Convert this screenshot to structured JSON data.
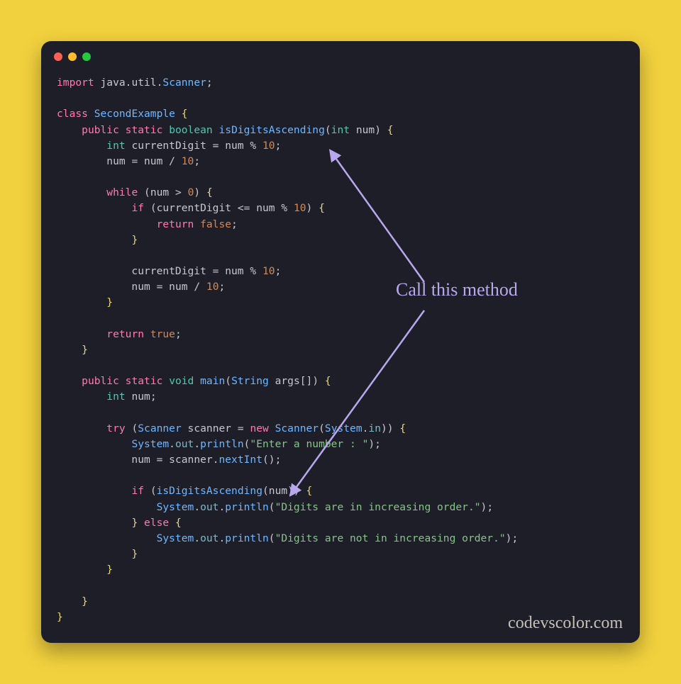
{
  "colors": {
    "page_bg": "#f2d13e",
    "editor_bg": "#1e1e28",
    "keyword": "#ff7ab2",
    "type": "#4ec9b0",
    "class": "#6fb7ff",
    "number": "#d08a5a",
    "brace": "#e8d87a",
    "string": "#87c38a",
    "annotation": "#b9a8ee"
  },
  "window": {
    "controls": [
      "close",
      "minimize",
      "zoom"
    ]
  },
  "code": {
    "lines": [
      [
        [
          "kw",
          "import"
        ],
        [
          "punc",
          " java"
        ],
        [
          "punc",
          "."
        ],
        [
          "punc",
          "util"
        ],
        [
          "punc",
          "."
        ],
        [
          "cls",
          "Scanner"
        ],
        [
          "punc",
          ";"
        ]
      ],
      [],
      [
        [
          "kw",
          "class"
        ],
        [
          "punc",
          " "
        ],
        [
          "cls",
          "SecondExample"
        ],
        [
          "punc",
          " "
        ],
        [
          "brace",
          "{"
        ]
      ],
      [
        [
          "punc",
          "    "
        ],
        [
          "kw",
          "public"
        ],
        [
          "punc",
          " "
        ],
        [
          "kw",
          "static"
        ],
        [
          "punc",
          " "
        ],
        [
          "type",
          "boolean"
        ],
        [
          "punc",
          " "
        ],
        [
          "fn",
          "isDigitsAscending"
        ],
        [
          "punc",
          "("
        ],
        [
          "type",
          "int"
        ],
        [
          "punc",
          " num"
        ],
        [
          "punc",
          ")"
        ],
        [
          "punc",
          " "
        ],
        [
          "brace",
          "{"
        ]
      ],
      [
        [
          "punc",
          "        "
        ],
        [
          "type",
          "int"
        ],
        [
          "punc",
          " currentDigit "
        ],
        [
          "op",
          "="
        ],
        [
          "punc",
          " num "
        ],
        [
          "op",
          "%"
        ],
        [
          "punc",
          " "
        ],
        [
          "num",
          "10"
        ],
        [
          "punc",
          ";"
        ]
      ],
      [
        [
          "punc",
          "        num "
        ],
        [
          "op",
          "="
        ],
        [
          "punc",
          " num "
        ],
        [
          "op",
          "/"
        ],
        [
          "punc",
          " "
        ],
        [
          "num",
          "10"
        ],
        [
          "punc",
          ";"
        ]
      ],
      [],
      [
        [
          "punc",
          "        "
        ],
        [
          "kw",
          "while"
        ],
        [
          "punc",
          " "
        ],
        [
          "punc",
          "("
        ],
        [
          "punc",
          "num "
        ],
        [
          "op",
          ">"
        ],
        [
          "punc",
          " "
        ],
        [
          "num",
          "0"
        ],
        [
          "punc",
          ")"
        ],
        [
          "punc",
          " "
        ],
        [
          "brace",
          "{"
        ]
      ],
      [
        [
          "punc",
          "            "
        ],
        [
          "kw",
          "if"
        ],
        [
          "punc",
          " "
        ],
        [
          "punc",
          "("
        ],
        [
          "punc",
          "currentDigit "
        ],
        [
          "op",
          "<="
        ],
        [
          "punc",
          " num "
        ],
        [
          "op",
          "%"
        ],
        [
          "punc",
          " "
        ],
        [
          "num",
          "10"
        ],
        [
          "punc",
          ")"
        ],
        [
          "punc",
          " "
        ],
        [
          "brace",
          "{"
        ]
      ],
      [
        [
          "punc",
          "                "
        ],
        [
          "kw",
          "return"
        ],
        [
          "punc",
          " "
        ],
        [
          "num",
          "false"
        ],
        [
          "punc",
          ";"
        ]
      ],
      [
        [
          "punc",
          "            "
        ],
        [
          "brace",
          "}"
        ]
      ],
      [],
      [
        [
          "punc",
          "            currentDigit "
        ],
        [
          "op",
          "="
        ],
        [
          "punc",
          " num "
        ],
        [
          "op",
          "%"
        ],
        [
          "punc",
          " "
        ],
        [
          "num",
          "10"
        ],
        [
          "punc",
          ";"
        ]
      ],
      [
        [
          "punc",
          "            num "
        ],
        [
          "op",
          "="
        ],
        [
          "punc",
          " num "
        ],
        [
          "op",
          "/"
        ],
        [
          "punc",
          " "
        ],
        [
          "num",
          "10"
        ],
        [
          "punc",
          ";"
        ]
      ],
      [
        [
          "punc",
          "        "
        ],
        [
          "brace",
          "}"
        ]
      ],
      [],
      [
        [
          "punc",
          "        "
        ],
        [
          "kw",
          "return"
        ],
        [
          "punc",
          " "
        ],
        [
          "num",
          "true"
        ],
        [
          "punc",
          ";"
        ]
      ],
      [
        [
          "punc",
          "    "
        ],
        [
          "brace",
          "}"
        ]
      ],
      [],
      [
        [
          "punc",
          "    "
        ],
        [
          "kw",
          "public"
        ],
        [
          "punc",
          " "
        ],
        [
          "kw",
          "static"
        ],
        [
          "punc",
          " "
        ],
        [
          "type",
          "void"
        ],
        [
          "punc",
          " "
        ],
        [
          "fn",
          "main"
        ],
        [
          "punc",
          "("
        ],
        [
          "cls",
          "String"
        ],
        [
          "punc",
          " args"
        ],
        [
          "punc",
          "[]"
        ],
        [
          "punc",
          ")"
        ],
        [
          "punc",
          " "
        ],
        [
          "brace",
          "{"
        ]
      ],
      [
        [
          "punc",
          "        "
        ],
        [
          "type",
          "int"
        ],
        [
          "punc",
          " num"
        ],
        [
          "punc",
          ";"
        ]
      ],
      [],
      [
        [
          "punc",
          "        "
        ],
        [
          "kw",
          "try"
        ],
        [
          "punc",
          " "
        ],
        [
          "punc",
          "("
        ],
        [
          "cls",
          "Scanner"
        ],
        [
          "punc",
          " scanner "
        ],
        [
          "op",
          "="
        ],
        [
          "punc",
          " "
        ],
        [
          "kw",
          "new"
        ],
        [
          "punc",
          " "
        ],
        [
          "cls",
          "Scanner"
        ],
        [
          "punc",
          "("
        ],
        [
          "cls",
          "System"
        ],
        [
          "punc",
          "."
        ],
        [
          "prop",
          "in"
        ],
        [
          "punc",
          "))"
        ],
        [
          "punc",
          " "
        ],
        [
          "brace",
          "{"
        ]
      ],
      [
        [
          "punc",
          "            "
        ],
        [
          "cls",
          "System"
        ],
        [
          "punc",
          "."
        ],
        [
          "prop",
          "out"
        ],
        [
          "punc",
          "."
        ],
        [
          "fn",
          "println"
        ],
        [
          "punc",
          "("
        ],
        [
          "str",
          "\"Enter a number : \""
        ],
        [
          "punc",
          ")"
        ],
        [
          "punc",
          ";"
        ]
      ],
      [
        [
          "punc",
          "            num "
        ],
        [
          "op",
          "="
        ],
        [
          "punc",
          " scanner"
        ],
        [
          "punc",
          "."
        ],
        [
          "fn",
          "nextInt"
        ],
        [
          "punc",
          "()"
        ],
        [
          "punc",
          ";"
        ]
      ],
      [],
      [
        [
          "punc",
          "            "
        ],
        [
          "kw",
          "if"
        ],
        [
          "punc",
          " "
        ],
        [
          "punc",
          "("
        ],
        [
          "fn",
          "isDigitsAscending"
        ],
        [
          "punc",
          "("
        ],
        [
          "punc",
          "num"
        ],
        [
          "punc",
          "))"
        ],
        [
          "punc",
          " "
        ],
        [
          "brace",
          "{"
        ]
      ],
      [
        [
          "punc",
          "                "
        ],
        [
          "cls",
          "System"
        ],
        [
          "punc",
          "."
        ],
        [
          "prop",
          "out"
        ],
        [
          "punc",
          "."
        ],
        [
          "fn",
          "println"
        ],
        [
          "punc",
          "("
        ],
        [
          "str",
          "\"Digits are in increasing order.\""
        ],
        [
          "punc",
          ")"
        ],
        [
          "punc",
          ";"
        ]
      ],
      [
        [
          "punc",
          "            "
        ],
        [
          "brace",
          "}"
        ],
        [
          "punc",
          " "
        ],
        [
          "kw",
          "else"
        ],
        [
          "punc",
          " "
        ],
        [
          "brace",
          "{"
        ]
      ],
      [
        [
          "punc",
          "                "
        ],
        [
          "cls",
          "System"
        ],
        [
          "punc",
          "."
        ],
        [
          "prop",
          "out"
        ],
        [
          "punc",
          "."
        ],
        [
          "fn",
          "println"
        ],
        [
          "punc",
          "("
        ],
        [
          "str",
          "\"Digits are not in increasing order.\""
        ],
        [
          "punc",
          ")"
        ],
        [
          "punc",
          ";"
        ]
      ],
      [
        [
          "punc",
          "            "
        ],
        [
          "brace",
          "}"
        ]
      ],
      [
        [
          "punc",
          "        "
        ],
        [
          "brace",
          "}"
        ]
      ],
      [],
      [
        [
          "punc",
          "    "
        ],
        [
          "brace",
          "}"
        ]
      ],
      [
        [
          "brace",
          "}"
        ]
      ]
    ]
  },
  "annotation": {
    "text": "Call this method"
  },
  "watermark": "codevscolor.com"
}
